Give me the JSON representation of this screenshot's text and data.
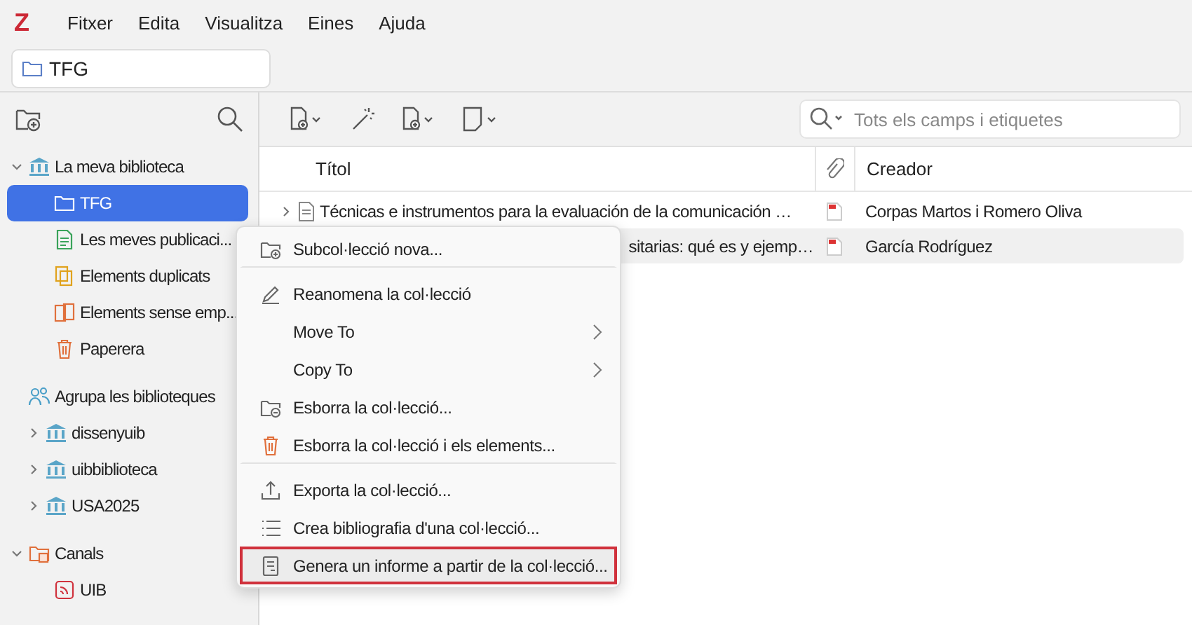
{
  "menu_bar": {
    "logo": "Z",
    "items": [
      "Fitxer",
      "Edita",
      "Visualitza",
      "Eines",
      "Ajuda"
    ]
  },
  "tabs": [
    {
      "label": "TFG",
      "selected": true
    }
  ],
  "sidebar": {
    "sections": [
      {
        "label": "La meva biblioteca",
        "kind": "library",
        "expanded": true,
        "children": [
          {
            "label": "TFG",
            "kind": "folder",
            "selected": true
          },
          {
            "label": "Les meves publicaci...",
            "kind": "publications",
            "selected": false
          },
          {
            "label": "Elements duplicats",
            "kind": "duplicates",
            "selected": false
          },
          {
            "label": "Elements sense emp...",
            "kind": "unfiled",
            "selected": false
          },
          {
            "label": "Paperera",
            "kind": "trash",
            "selected": false
          }
        ]
      },
      {
        "label": "Agrupa les biblioteques",
        "kind": "groups",
        "children": [
          {
            "label": "dissenyuib",
            "kind": "library",
            "expanded": false,
            "selected": false
          },
          {
            "label": "uibbiblioteca",
            "kind": "library",
            "expanded": false,
            "selected": false
          },
          {
            "label": "USA2025",
            "kind": "library",
            "expanded": false,
            "selected": false
          }
        ]
      },
      {
        "label": "Canals",
        "kind": "feeds",
        "expanded": true,
        "children": [
          {
            "label": "UIB",
            "kind": "feed",
            "selected": false
          }
        ]
      }
    ]
  },
  "search": {
    "placeholder": "Tots els camps i etiquetes"
  },
  "table": {
    "columns": [
      "Títol",
      "Creador"
    ],
    "rows": [
      {
        "title": "Técnicas e instrumentos para la evaluación de la comunicación …",
        "creator": "Corpas Martos i Romero Oliva",
        "covered": false,
        "selected": false
      },
      {
        "title": "sitarias: qué es y ejemp…",
        "creator": "García Rodríguez",
        "covered": true,
        "selected": true
      }
    ]
  },
  "context_menu": {
    "items": [
      {
        "label": "Subcol·lecció nova...",
        "kind": "new-folder",
        "submenu": false,
        "separator_after": true,
        "selected": false
      },
      {
        "label": "Reanomena la col·lecció",
        "kind": "rename",
        "submenu": false,
        "separator_after": false,
        "selected": false
      },
      {
        "label": "Move To",
        "kind": "none",
        "submenu": true,
        "separator_after": false,
        "selected": false
      },
      {
        "label": "Copy To",
        "kind": "none",
        "submenu": true,
        "separator_after": false,
        "selected": false
      },
      {
        "label": "Esborra la col·lecció...",
        "kind": "delete-folder",
        "submenu": false,
        "separator_after": false,
        "selected": false
      },
      {
        "label": "Esborra la col·lecció i els elements...",
        "kind": "trash",
        "submenu": false,
        "separator_after": true,
        "selected": false
      },
      {
        "label": "Exporta la col·lecció...",
        "kind": "export",
        "submenu": false,
        "separator_after": false,
        "selected": false
      },
      {
        "label": "Crea bibliografia d'una col·lecció...",
        "kind": "list",
        "submenu": false,
        "separator_after": false,
        "selected": false
      },
      {
        "label": "Genera un informe a partir de la col·lecció...",
        "kind": "report",
        "submenu": false,
        "separator_after": false,
        "selected": true
      }
    ]
  }
}
